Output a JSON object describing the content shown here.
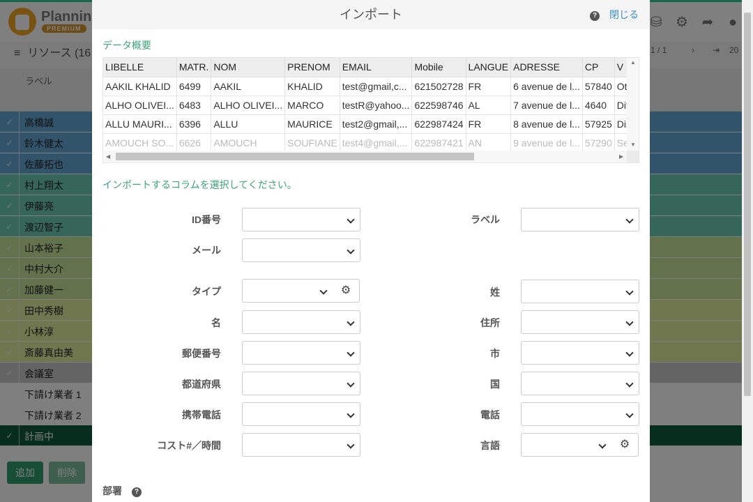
{
  "app": {
    "brand": "Planning",
    "badge": "PREMIUM",
    "resources_title": "リソース (16",
    "pager_text": "1 / 1",
    "pager_count": "20",
    "label_column": "ラベル"
  },
  "resources": [
    {
      "name": "高橋誠",
      "color": "#63a9d6"
    },
    {
      "name": "鈴木健太",
      "color": "#63a9d6"
    },
    {
      "name": "佐藤拓也",
      "color": "#63a9d6"
    },
    {
      "name": "村上翔太",
      "color": "#6dcbb3"
    },
    {
      "name": "伊藤亮",
      "color": "#6dcbb3"
    },
    {
      "name": "渡辺智子",
      "color": "#6dcbb3"
    },
    {
      "name": "山本裕子",
      "color": "#c9e39a"
    },
    {
      "name": "中村大介",
      "color": "#c9e39a"
    },
    {
      "name": "加藤健一",
      "color": "#c9e39a"
    },
    {
      "name": "田中秀樹",
      "color": "#e0ec9c"
    },
    {
      "name": "小林淳",
      "color": "#e0ec9c"
    },
    {
      "name": "斎藤真由美",
      "color": "#e0ec9c"
    },
    {
      "name": "会議室",
      "color": "#c8c8c8"
    },
    {
      "name": "下請け業者 1",
      "color": "#ffffff"
    },
    {
      "name": "下請け業者 2",
      "color": "#ffffff"
    },
    {
      "name": "計画中",
      "color": "#0d5a3d"
    }
  ],
  "footer": {
    "add": "追加",
    "delete": "削除"
  },
  "modal": {
    "title": "インポート",
    "close": "閉じる",
    "overview": "データ概要",
    "choose_columns": "インポートするコラムを選択してください。",
    "department": "部署",
    "table": {
      "headers": [
        "LIBELLE",
        "MATR.",
        "NOM",
        "PRENOM",
        "EMAIL",
        "Mobile",
        "LANGUE",
        "ADRESSE",
        "CP",
        "V ILLE"
      ],
      "rows": [
        [
          "AAKIL KHALID",
          "6499",
          "AAKIL",
          "KHALID",
          "test@gmail,c...",
          "621502728",
          "FR",
          "6 avenue de l...",
          "57840",
          "Ottange"
        ],
        [
          "ALHO OLIVEI...",
          "6483",
          "ALHO OLIVEI...",
          "MARCO",
          "testR@yahoo...",
          "622598746",
          "AL",
          "7 avenue de l...",
          "4640",
          "Differda"
        ],
        [
          "ALLU MAURI...",
          "6396",
          "ALLU",
          "MAURICE",
          "test2@gmail,...",
          "622987424",
          "FR",
          "8 avenue de l...",
          "57925",
          "Distrof"
        ],
        [
          "AMOUCH SO...",
          "6626",
          "AMOUCH",
          "SOUFIANE",
          "test4@gmail,...",
          "622987421",
          "AN",
          "9 avenue de l...",
          "57290",
          "Seremi"
        ]
      ]
    },
    "fields": {
      "id": "ID番号",
      "label": "ラベル",
      "mail": "メール",
      "type": "タイプ",
      "last_name": "姓",
      "first_name": "名",
      "address": "住所",
      "postal": "郵便番号",
      "city": "市",
      "prefecture": "都道府県",
      "country": "国",
      "mobile": "携帯電話",
      "phone": "電話",
      "cost": "コスト#／時間",
      "language": "言語"
    }
  }
}
